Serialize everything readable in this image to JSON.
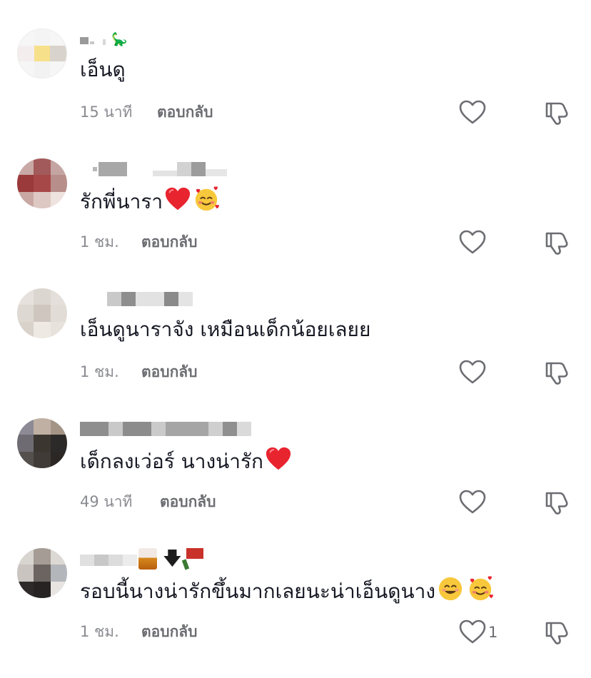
{
  "comments": [
    {
      "text": "เอ็นดู",
      "time": "15 นาที",
      "reply_label": "ตอบกลับ",
      "emojis": [],
      "like_count": ""
    },
    {
      "text": "รักพี่นารา",
      "time": "1 ชม.",
      "reply_label": "ตอบกลับ",
      "emojis": [
        "red-heart",
        "smiling-face-with-hearts"
      ],
      "like_count": ""
    },
    {
      "text": "เอ็นดูนาราจัง เหมือนเด็กน้อยเลยย",
      "time": "1 ชม.",
      "reply_label": "ตอบกลับ",
      "emojis": [],
      "like_count": ""
    },
    {
      "text": "เด็กลงเว่อร์ นางน่ารัก",
      "time": "49 นาที",
      "reply_label": "ตอบกลับ",
      "emojis": [
        "red-heart"
      ],
      "like_count": ""
    },
    {
      "text": "รอบนี้นางน่ารักขึ้นมากเลยนะน่าเอ็นดูนาง",
      "time": "1 ชม.",
      "reply_label": "ตอบกลับ",
      "emojis": [
        "smiling-face",
        "smiling-face-with-hearts"
      ],
      "like_count": "1"
    }
  ],
  "icons": {
    "like": "heart-outline-icon",
    "dislike": "thumbs-down-outline-icon"
  },
  "colors": {
    "text": "#161823",
    "muted": "#8a8b91",
    "heart": "#e8242f"
  }
}
